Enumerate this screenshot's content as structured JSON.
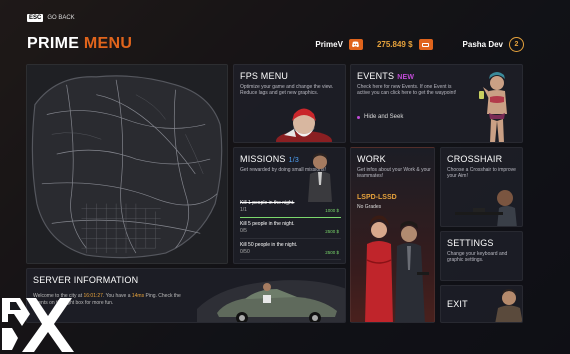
{
  "header": {
    "esc_key": "ESC",
    "go_back": "GO BACK",
    "title_part1": "PRIME",
    "title_part2": "MENU",
    "username": "PrimeV",
    "money": "275.849 $",
    "player_name": "Pasha Dev",
    "level": "2"
  },
  "tiles": {
    "fps": {
      "title": "FPS MENU",
      "desc": "Optimize your game and change the view. Reduce lags and get new graphics."
    },
    "events": {
      "title": "EVENTS",
      "badge": "NEW",
      "desc": "Check here for new Events. If one Event is active you can click here to get the waypoint!",
      "item": "Hide and Seek"
    },
    "missions": {
      "title": "MISSIONS",
      "count": "1/3",
      "desc": "Get rewarded by doing small missions!",
      "items": [
        {
          "name": "Kill 1 people in the night.",
          "progress": "1/1",
          "reward": "1000 $",
          "fill": 1.0,
          "done": true
        },
        {
          "name": "Kill 5 people in the night.",
          "progress": "0/5",
          "reward": "2500 $",
          "fill": 0.0,
          "done": false
        },
        {
          "name": "Kill 50 people in the night.",
          "progress": "0/50",
          "reward": "2500 $",
          "fill": 0.0,
          "done": false
        }
      ]
    },
    "work": {
      "title": "WORK",
      "desc": "Get infos about your Work & your teammates!",
      "job": "LSPD-LSSD",
      "grade": "No Grades"
    },
    "crosshair": {
      "title": "CROSSHAIR",
      "desc": "Choose a Crosshair to improve your Aim!"
    },
    "settings": {
      "title": "SETTINGS",
      "desc": "Change your keyboard and graphic settings."
    },
    "exit": {
      "title": "EXIT"
    },
    "server": {
      "title": "SERVER INFORMATION",
      "text_a": "Welcome to the city at ",
      "time": "16:01:27",
      "text_b": ". You have a ",
      "ping": "14ms",
      "text_c": " Ping. Check the events on the right box for more fun."
    }
  },
  "colors": {
    "accent": "#e0641c",
    "money": "#e6a23c",
    "new_badge": "#c04bd6",
    "mission_count": "#4fa2f7",
    "reward": "#7bd86c"
  },
  "icons": {
    "discord": "discord-icon",
    "cash": "cash-icon",
    "event_bullet": "bullet-icon",
    "logo": "px-logo"
  }
}
